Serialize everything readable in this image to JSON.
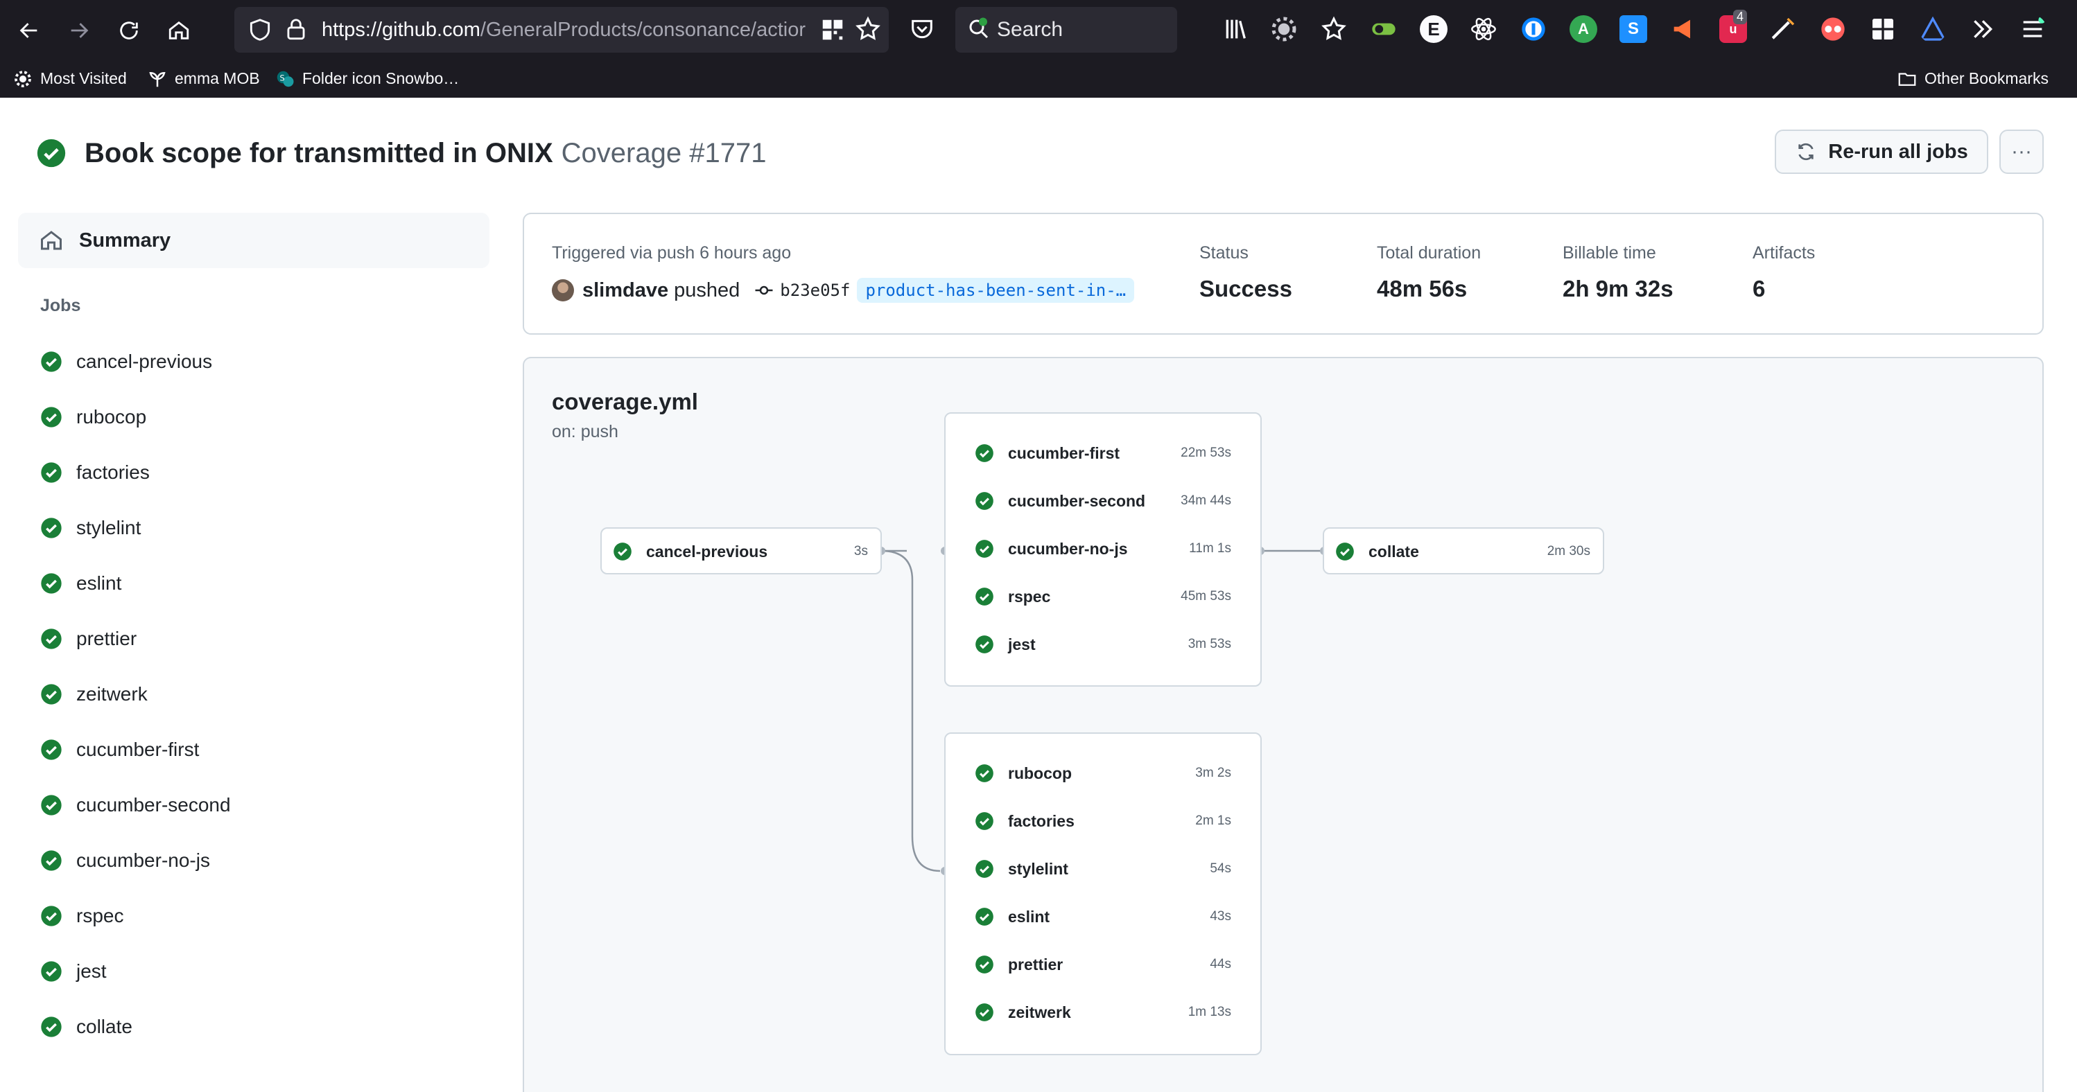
{
  "browser": {
    "url_host": "https://github.com",
    "url_path": "/GeneralProducts/consonance/actior",
    "search_label": "Search",
    "bookmarks": [
      {
        "label": "Most Visited"
      },
      {
        "label": "emma MOB"
      },
      {
        "label": "Folder icon Snowbo…"
      },
      {
        "label": "Other Bookmarks"
      }
    ],
    "extension_badge": "4"
  },
  "header": {
    "title": "Book scope for transmitted in ONIX",
    "subtitle": "Coverage #1771",
    "rerun_label": "Re-run all jobs",
    "more_label": "···"
  },
  "sidebar": {
    "summary_label": "Summary",
    "jobs_heading": "Jobs",
    "jobs": [
      {
        "label": "cancel-previous"
      },
      {
        "label": "rubocop"
      },
      {
        "label": "factories"
      },
      {
        "label": "stylelint"
      },
      {
        "label": "eslint"
      },
      {
        "label": "prettier"
      },
      {
        "label": "zeitwerk"
      },
      {
        "label": "cucumber-first"
      },
      {
        "label": "cucumber-second"
      },
      {
        "label": "cucumber-no-js"
      },
      {
        "label": "rspec"
      },
      {
        "label": "jest"
      },
      {
        "label": "collate"
      }
    ]
  },
  "summary": {
    "triggered": "Triggered via push 6 hours ago",
    "pusher": "slimdave",
    "pushed_word": "pushed",
    "sha": "b23e05f",
    "branch": "product-has-been-sent-in-…",
    "stats": [
      {
        "label": "Status",
        "value": "Success"
      },
      {
        "label": "Total duration",
        "value": "48m 56s"
      },
      {
        "label": "Billable time",
        "value": "2h 9m 32s"
      },
      {
        "label": "Artifacts",
        "value": "6"
      }
    ]
  },
  "workflow": {
    "file": "coverage.yml",
    "trigger": "on: push",
    "groups": [
      {
        "id": "g0",
        "jobs": [
          {
            "name": "cancel-previous",
            "duration": "3s"
          }
        ]
      },
      {
        "id": "g1",
        "jobs": [
          {
            "name": "cucumber-first",
            "duration": "22m 53s"
          },
          {
            "name": "cucumber-second",
            "duration": "34m 44s"
          },
          {
            "name": "cucumber-no-js",
            "duration": "11m 1s"
          },
          {
            "name": "rspec",
            "duration": "45m 53s"
          },
          {
            "name": "jest",
            "duration": "3m 53s"
          }
        ]
      },
      {
        "id": "g2",
        "jobs": [
          {
            "name": "rubocop",
            "duration": "3m 2s"
          },
          {
            "name": "factories",
            "duration": "2m 1s"
          },
          {
            "name": "stylelint",
            "duration": "54s"
          },
          {
            "name": "eslint",
            "duration": "43s"
          },
          {
            "name": "prettier",
            "duration": "44s"
          },
          {
            "name": "zeitwerk",
            "duration": "1m 13s"
          }
        ]
      },
      {
        "id": "g3",
        "jobs": [
          {
            "name": "collate",
            "duration": "2m 30s"
          }
        ]
      }
    ]
  },
  "colors": {
    "success": "#1a7f37",
    "chrome_bg": "#1c1b22",
    "link": "#0969da"
  }
}
